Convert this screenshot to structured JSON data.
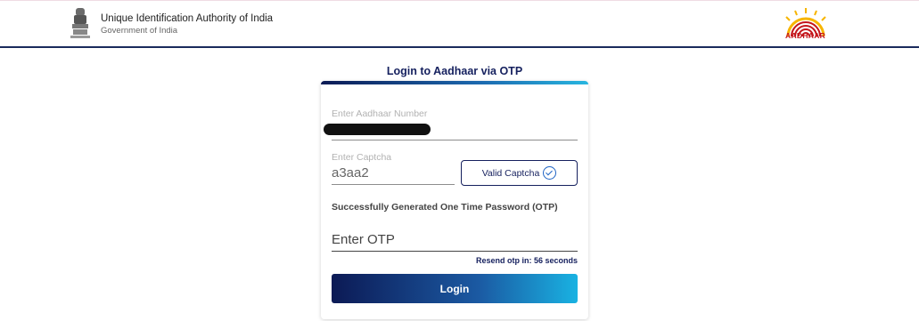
{
  "header": {
    "org_name": "Unique Identification Authority of India",
    "org_sub": "Government of India",
    "emblem_icon": "national-emblem-icon",
    "brand_logo": "aadhaar-logo",
    "brand_text": "AADHAAR"
  },
  "login": {
    "title": "Login to Aadhaar via OTP",
    "aadhaar_label": "Enter Aadhaar Number",
    "captcha_label": "Enter Captcha",
    "captcha_value": "a3aa2",
    "valid_captcha_label": "Valid Captcha",
    "success_message": "Successfully Generated One Time Password (OTP)",
    "otp_placeholder": "Enter OTP",
    "resend_text": "Resend otp in: 56 seconds",
    "login_button": "Login"
  },
  "colors": {
    "primary": "#15205e",
    "accent": "#28b6e0",
    "brand_red": "#c4161c",
    "brand_yellow": "#f7b500"
  }
}
